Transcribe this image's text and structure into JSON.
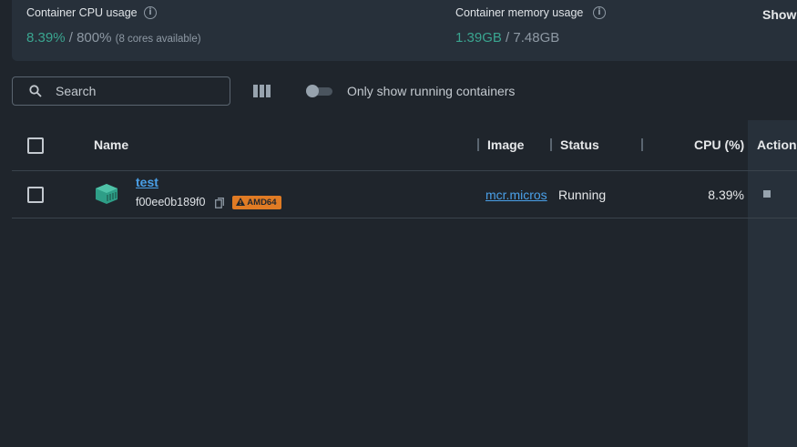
{
  "stats": {
    "cpu": {
      "label": "Container CPU usage",
      "value": "8.39%",
      "separator": "/",
      "total": "800%",
      "cores_note": "(8 cores available)"
    },
    "memory": {
      "label": "Container memory usage",
      "value": "1.39GB",
      "separator": "/",
      "total": "7.48GB"
    },
    "show_button": "Show"
  },
  "toolbar": {
    "search_placeholder": "Search",
    "toggle_label": "Only show running containers",
    "toggle_on": false
  },
  "table": {
    "headers": {
      "name": "Name",
      "image": "Image",
      "status": "Status",
      "cpu": "CPU (%)",
      "actions": "Actions"
    },
    "rows": [
      {
        "name": "test",
        "container_id": "f00ee0b189f0",
        "badge": "AMD64",
        "image": "mcr.micros",
        "status": "Running",
        "cpu": "8.39%"
      }
    ]
  },
  "colors": {
    "background": "#1f252c",
    "panel": "#27303a",
    "accent_green": "#3aa590",
    "link_blue": "#4aa0e8",
    "badge_orange": "#e07b24"
  },
  "icons": [
    "info-icon",
    "search-icon",
    "columns-icon",
    "toggle-switch",
    "container-icon",
    "copy-icon",
    "warning-icon",
    "stop-icon"
  ]
}
